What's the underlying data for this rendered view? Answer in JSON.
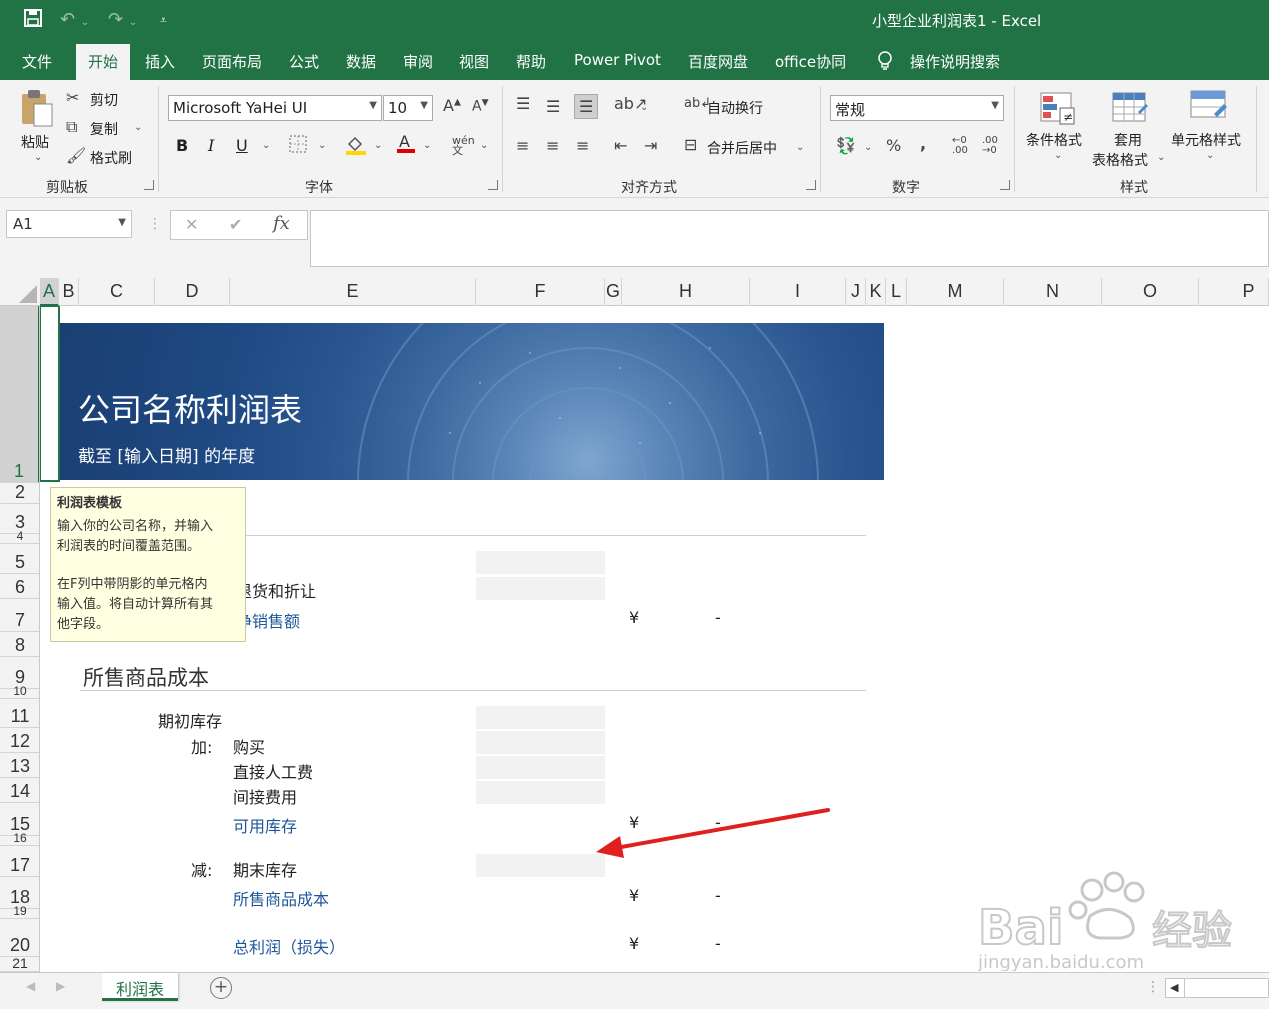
{
  "window": {
    "title": "小型企业利润表1  -  Excel"
  },
  "menu": {
    "tabs": [
      "文件",
      "开始",
      "插入",
      "页面布局",
      "公式",
      "数据",
      "审阅",
      "视图",
      "帮助",
      "Power Pivot",
      "百度网盘",
      "office协同"
    ],
    "active": "开始",
    "search_label": "操作说明搜索"
  },
  "ribbon": {
    "clipboard": {
      "paste": "粘贴",
      "cut": "剪切",
      "copy": "复制",
      "format_painter": "格式刷",
      "label": "剪贴板"
    },
    "font": {
      "font_name": "Microsoft YaHei UI",
      "font_size": "10",
      "bold": "B",
      "italic": "I",
      "underline": "U",
      "label": "字体",
      "highlight_color": "#ffd700",
      "font_color": "#e00000"
    },
    "alignment": {
      "wrap_text": "自动换行",
      "merge_center": "合并后居中",
      "label": "对齐方式"
    },
    "number": {
      "format": "常规",
      "label": "数字"
    },
    "styles": {
      "conditional": "条件格式",
      "table_format_line1": "套用",
      "table_format_line2": "表格格式",
      "cell_styles": "单元格样式",
      "label": "样式"
    }
  },
  "formula_bar": {
    "name_box": "A1",
    "cancel": "✕",
    "enter": "✔",
    "fx": "fx",
    "content": ""
  },
  "columns": [
    "A",
    "B",
    "C",
    "D",
    "E",
    "F",
    "G",
    "H",
    "I",
    "J",
    "K",
    "L",
    "M",
    "N",
    "O",
    "P"
  ],
  "selected_column": "A",
  "rows": [
    "1",
    "2",
    "3",
    "4",
    "5",
    "6",
    "7",
    "8",
    "9",
    "10",
    "11",
    "12",
    "13",
    "14",
    "15",
    "16",
    "17",
    "18",
    "19",
    "20",
    "21"
  ],
  "selected_row": "1",
  "banner": {
    "title": "公司名称利润表",
    "subtitle": "截至 [输入日期] 的年度"
  },
  "tooltip": {
    "title": "利润表模板",
    "line1": "输入你的公司名称，并输入",
    "line2": "利润表的时间覆盖范围。",
    "line3": "在F列中带阴影的单元格内",
    "line4": "输入值。将自动计算所有其",
    "line5": "他字段。"
  },
  "sheet": {
    "row6_label": "退货和折让",
    "row7_label": "净销售额",
    "section_cogs": "所售商品成本",
    "row11_label": "期初库存",
    "row12_prefix": "加:",
    "row12_label": "购买",
    "row13_label": "直接人工费",
    "row14_label": "间接费用",
    "row15_label": "可用库存",
    "row17_prefix": "减:",
    "row17_label": "期末库存",
    "row18_label": "所售商品成本",
    "row20_label": "总利润（损失）",
    "currency": "¥",
    "dash": "-"
  },
  "sheet_tabs": {
    "active": "利润表",
    "add": "+"
  },
  "colors": {
    "excel_green": "#217346",
    "banner_blue": "#1f4a83",
    "arrow_red": "#e02020",
    "label_blue": "#1f5799"
  }
}
